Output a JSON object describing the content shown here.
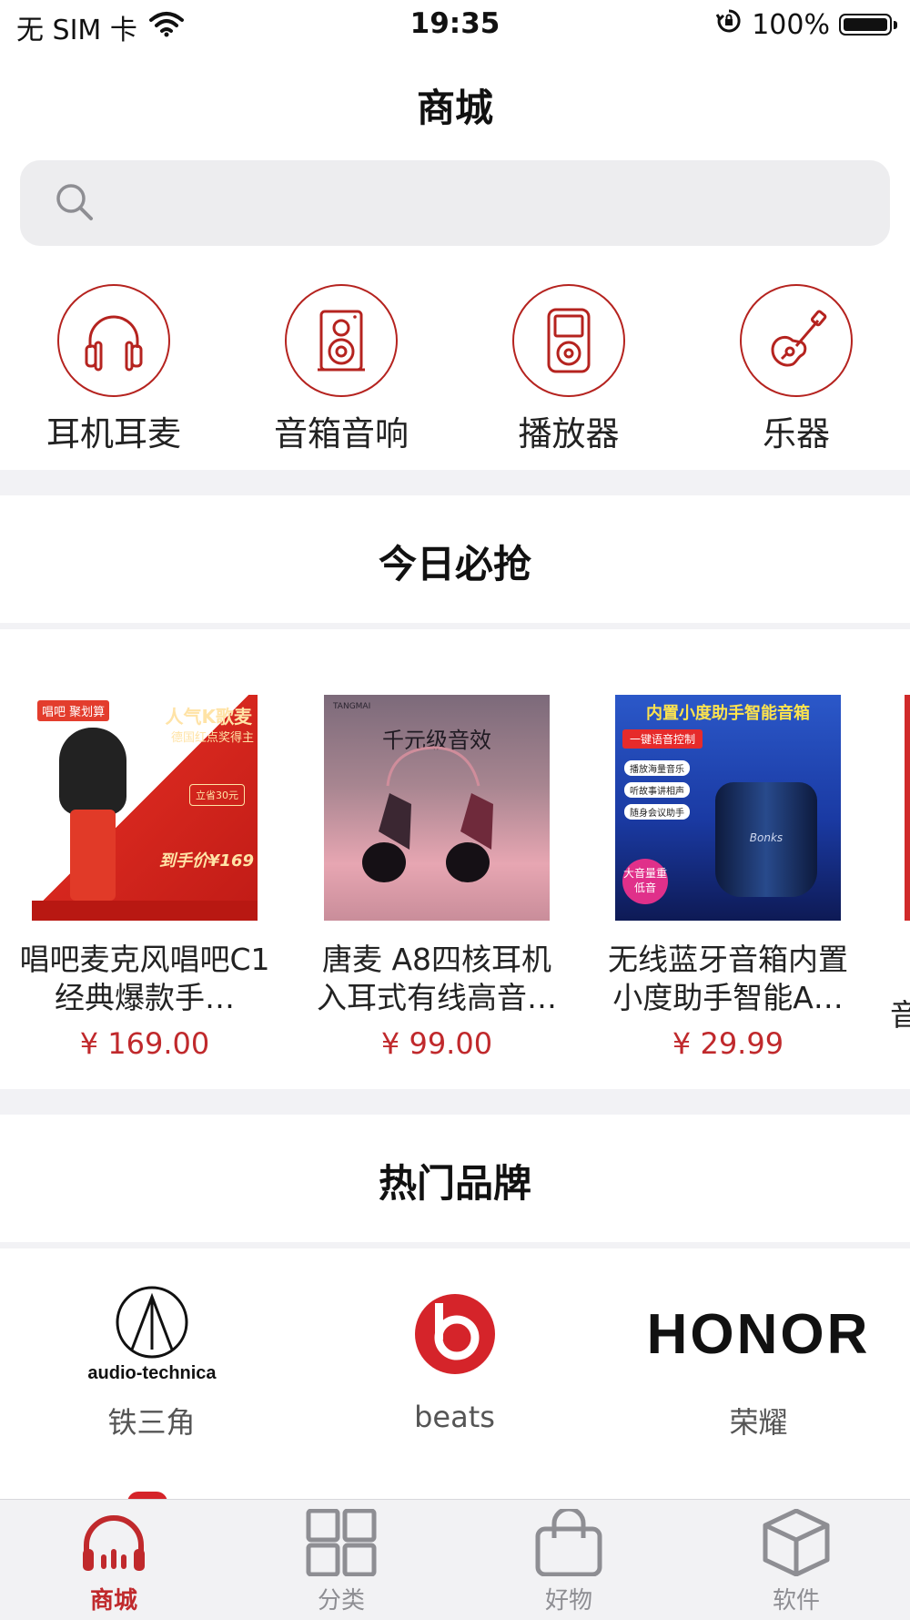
{
  "status_bar": {
    "carrier": "无 SIM 卡",
    "time": "19:35",
    "battery": "100%"
  },
  "page": {
    "title": "商城"
  },
  "search": {
    "placeholder": ""
  },
  "categories": [
    {
      "label": "耳机耳麦",
      "icon": "headphones-icon"
    },
    {
      "label": "音箱音响",
      "icon": "speaker-icon"
    },
    {
      "label": "播放器",
      "icon": "music-player-icon"
    },
    {
      "label": "乐器",
      "icon": "guitar-icon"
    }
  ],
  "today_deals": {
    "title": "今日必抢",
    "products": [
      {
        "name": "唱吧麦克风唱吧C1经典爆款手…",
        "price": "¥ 169.00",
        "img_text": [
          "唱吧 聚划算",
          "人气K歌麦",
          "德国红点奖得主",
          "立省30元",
          "到手价¥169"
        ]
      },
      {
        "name": "唐麦 A8四核耳机入耳式有线高音…",
        "price": "¥ 99.00",
        "img_text": [
          "TANGMAI",
          "千元级音效"
        ]
      },
      {
        "name": "无线蓝牙音箱内置小度助手智能A…",
        "price": "¥ 29.99",
        "img_text": [
          "内置小度助手智能音箱",
          "一键语音控制",
          "播放海量音乐",
          "听故事讲相声",
          "随身会议助手",
          "大音量重低音",
          "Bonks"
        ]
      }
    ],
    "partial_next": "音"
  },
  "brands": {
    "title": "热门品牌",
    "items": [
      {
        "name": "铁三角",
        "logo_text": "audio-technica"
      },
      {
        "name": "beats",
        "logo_text": "b"
      },
      {
        "name": "荣耀",
        "logo_text": "HONOR"
      }
    ]
  },
  "tabbar": {
    "active_color": "#c0292c",
    "inactive_color": "#8e8e93",
    "tabs": [
      {
        "label": "商城",
        "icon": "headphones-icon",
        "active": true
      },
      {
        "label": "分类",
        "icon": "grid-icon",
        "active": false
      },
      {
        "label": "好物",
        "icon": "shopping-bag-icon",
        "active": false
      },
      {
        "label": "软件",
        "icon": "box-icon",
        "active": false
      }
    ]
  },
  "colors": {
    "accent": "#b5231f",
    "price": "#c0292c",
    "divider": "#f2f2f5"
  }
}
